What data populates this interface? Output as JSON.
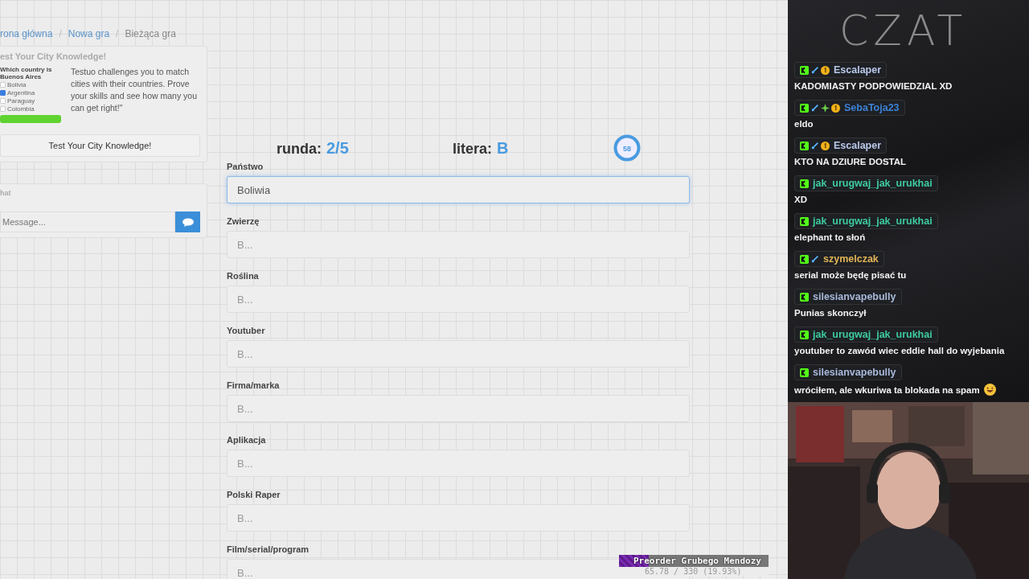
{
  "breadcrumb_separator": "/",
  "breadcrumb": [
    {
      "label": "rona główna",
      "link": true
    },
    {
      "label": "Nowa gra",
      "link": true
    },
    {
      "label": "Bieżąca gra",
      "link": false
    }
  ],
  "promo": {
    "title": "est Your City Knowledge!",
    "quiz": {
      "question": "Which country is Buenos Aires",
      "options": [
        {
          "label": "Bolivia",
          "checked": false
        },
        {
          "label": "Argentina",
          "checked": true
        },
        {
          "label": "Paraguay",
          "checked": false
        },
        {
          "label": "Colombia",
          "checked": false
        }
      ]
    },
    "text": "Testuo challenges you to match cities with their countries. Prove your skills and see how many you can get right!\"",
    "button": "Test Your City Knowledge!"
  },
  "site_chat": {
    "title": "hat",
    "placeholder": "Message..."
  },
  "game": {
    "round_label": "runda:",
    "round": "2/5",
    "letter_label": "litera:",
    "letter": "B",
    "timer": "58"
  },
  "fields": [
    {
      "label": "Państwo",
      "value": "Boliwia",
      "focused": true
    },
    {
      "label": "Zwierzę",
      "placeholder": "B...",
      "focused": false
    },
    {
      "label": "Roślina",
      "placeholder": "B...",
      "focused": false
    },
    {
      "label": "Youtuber",
      "placeholder": "B...",
      "focused": false
    },
    {
      "label": "Firma/marka",
      "placeholder": "B...",
      "focused": false
    },
    {
      "label": "Aplikacja",
      "placeholder": "B...",
      "focused": false
    },
    {
      "label": "Polski Raper",
      "placeholder": "B...",
      "focused": false
    },
    {
      "label": "Film/serial/program",
      "placeholder": "B...",
      "focused": false
    }
  ],
  "goal": {
    "title": "Preorder Grubego Mendozy",
    "reading": "65.78 / 330 (19.93%)",
    "level": 0.1993
  },
  "stream_chat": {
    "title": "CZAT",
    "messages": [
      {
        "user": "Escalaper",
        "color": "#b9c8ea",
        "sword": true,
        "star": false,
        "coin": true,
        "text": "KADOMIASTY PODPOWIEDZIAL XD"
      },
      {
        "user": "SebaToja23",
        "color": "#3d82d6",
        "sword": true,
        "star": true,
        "coin": true,
        "text": "eldo"
      },
      {
        "user": "Escalaper",
        "color": "#b9c8ea",
        "sword": true,
        "star": false,
        "coin": true,
        "text": "KTO NA DZIURE DOSTAL"
      },
      {
        "user": "jak_urugwaj_jak_urukhai",
        "color": "#3ecba0",
        "sword": false,
        "star": false,
        "coin": false,
        "text": "XD"
      },
      {
        "user": "jak_urugwaj_jak_urukhai",
        "color": "#3ecba0",
        "sword": false,
        "star": false,
        "coin": false,
        "text": "elephant to słoń"
      },
      {
        "user": "szymelczak",
        "color": "#e2b455",
        "sword": true,
        "star": false,
        "coin": false,
        "text": "serial może będę pisać tu"
      },
      {
        "user": "silesianvapebully",
        "color": "#a9b9da",
        "sword": false,
        "star": false,
        "coin": false,
        "text": "Punias skonczył"
      },
      {
        "user": "jak_urugwaj_jak_urukhai",
        "color": "#3ecba0",
        "sword": false,
        "star": false,
        "coin": false,
        "text": "youtuber to zawód wiec eddie hall do wyjebania"
      },
      {
        "user": "silesianvapebully",
        "color": "#a9b9da",
        "sword": false,
        "star": false,
        "coin": false,
        "text": "wróciłem, ale wkuriwa ta blokada na spam",
        "emoji": true
      }
    ]
  }
}
